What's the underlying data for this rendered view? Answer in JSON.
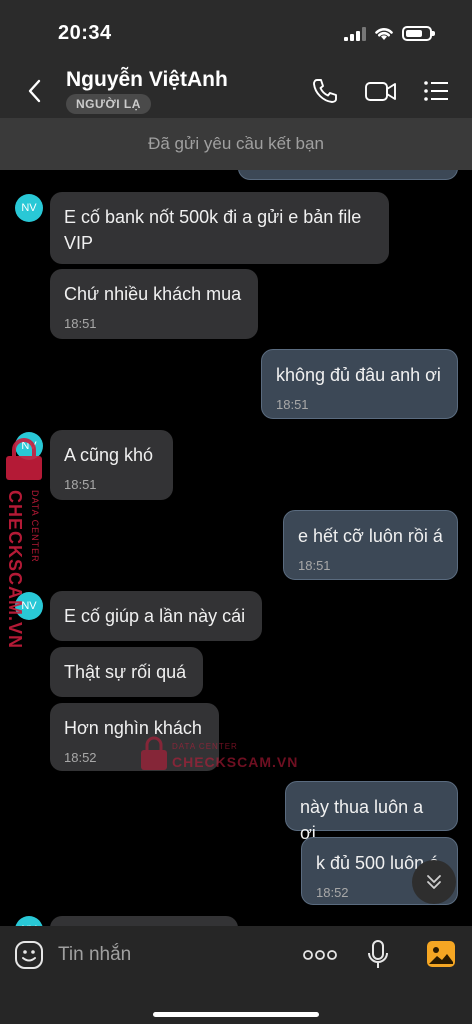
{
  "status_bar": {
    "time": "20:34"
  },
  "header": {
    "contact_name": "Nguyễn ViệtAnh",
    "badge": "NGƯỜI LẠ",
    "icons": [
      "back-icon",
      "phone-icon",
      "video-call-icon",
      "menu-list-icon"
    ]
  },
  "notice": "Đã gửi yêu cầu kết bạn",
  "avatar_initials": "NV",
  "messages": [
    {
      "dir": "in",
      "text": "E cố bank nốt 500k đi a gửi e bản file VIP",
      "time": ""
    },
    {
      "dir": "in",
      "text": "Chứ nhiều khách mua",
      "time": "18:51"
    },
    {
      "dir": "out",
      "text": "không đủ đâu anh ơi",
      "time": "18:51"
    },
    {
      "dir": "in",
      "text": "A cũng khó",
      "time": "18:51"
    },
    {
      "dir": "out",
      "text": "e hết cỡ luôn rồi á",
      "time": "18:51"
    },
    {
      "dir": "in",
      "text": "E cố giúp a lần này cái",
      "time": ""
    },
    {
      "dir": "in",
      "text": "Thật sự rối quá",
      "time": ""
    },
    {
      "dir": "in",
      "text": "Hơn nghìn khách",
      "time": "18:52"
    },
    {
      "dir": "out",
      "text": "này thua luôn a ơi",
      "time": ""
    },
    {
      "dir": "out",
      "text": "k đủ 500 luôn á",
      "time": "18:52"
    }
  ],
  "watermark": {
    "brand": "CHECKSCAM.VN",
    "sub": "DATA CENTER"
  },
  "input": {
    "placeholder": "Tin nhắn"
  },
  "colors": {
    "avatar": "#29c8d6",
    "outgoing_bubble": "#3c4856",
    "incoming_bubble": "#333335",
    "watermark": "#c81d3c",
    "gallery_icon": "#f5a623"
  }
}
